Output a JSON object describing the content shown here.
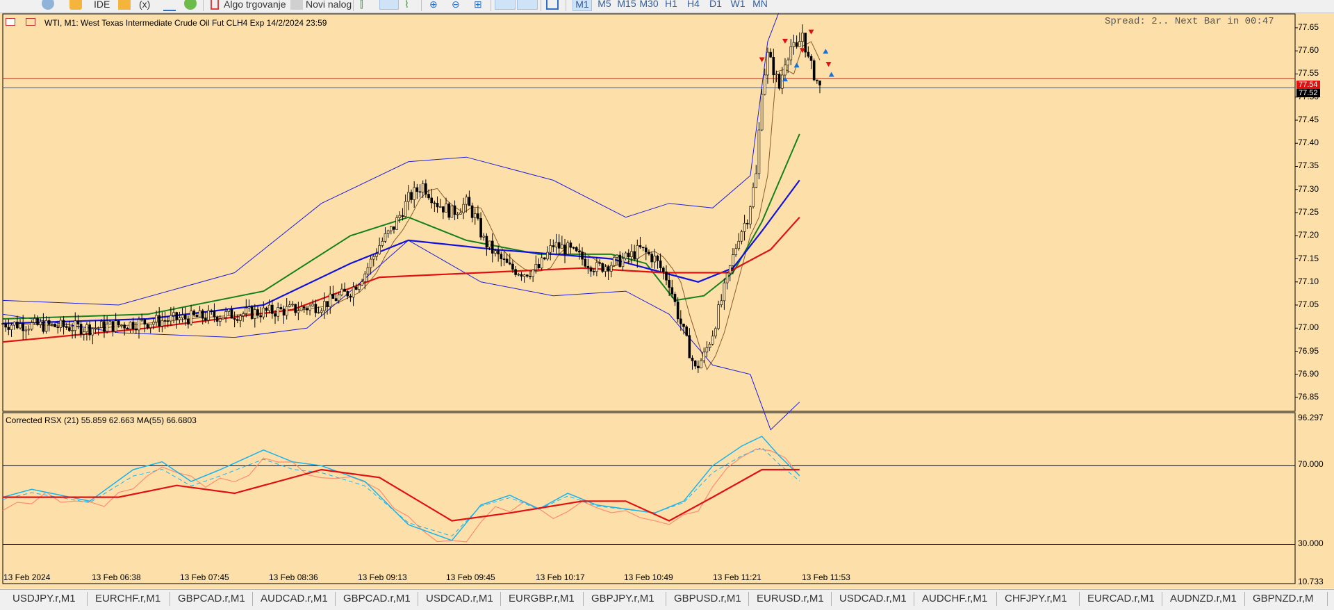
{
  "toolbar": {
    "items": [
      "IDE",
      "Algo trgovanje",
      "Novi nalog"
    ],
    "timeframes": [
      "M1",
      "M5",
      "M15",
      "M30",
      "H1",
      "H4",
      "D1",
      "W1",
      "MN"
    ],
    "active_timeframe": "M1"
  },
  "chart": {
    "symbol_info": "WTI, M1:  West Texas Intermediate Crude Oil Fut CLH4 Exp 14/2/2024 23:59",
    "spread_info": "Spread: 2.. Next Bar in 00:47",
    "ask_tag": "77.54",
    "bid_tag": "77.52",
    "price_ticks": [
      "77.65",
      "77.60",
      "77.55",
      "77.50",
      "77.45",
      "77.40",
      "77.35",
      "77.30",
      "77.25",
      "77.20",
      "77.15",
      "77.10",
      "77.05",
      "77.00",
      "76.95",
      "76.90",
      "76.85"
    ],
    "indicator_label": "Corrected RSX (21) 55.859 62.663 MA(55) 66.6803",
    "indicator_ticks": [
      "96.297",
      "70.000",
      "30.000",
      "10.733"
    ],
    "time_labels": [
      "13 Feb 2024",
      "13 Feb 06:38",
      "13 Feb 07:45",
      "13 Feb 08:36",
      "13 Feb 09:13",
      "13 Feb 09:45",
      "13 Feb 10:17",
      "13 Feb 10:49",
      "13 Feb 11:21",
      "13 Feb 11:53"
    ],
    "colors": {
      "background": "#fde0a9",
      "bollinger": "#1d1de0",
      "ema_green": "#14801e",
      "ema_blue": "#1010e0",
      "ema_red": "#e01010",
      "rsx_fast": "#17b3ee",
      "rsx_signal": "#e01010",
      "rsx_slow": "#ff8c70",
      "ask_line": "#e01010",
      "bid_line": "#555555"
    }
  },
  "chart_data": {
    "type": "candlestick",
    "timeframe": "M1",
    "y_range": [
      76.82,
      77.68
    ],
    "x_labels": [
      "13 Feb 2024",
      "13 Feb 06:38",
      "13 Feb 07:45",
      "13 Feb 08:36",
      "13 Feb 09:13",
      "13 Feb 09:45",
      "13 Feb 10:17",
      "13 Feb 10:49",
      "13 Feb 11:21",
      "13 Feb 11:53"
    ],
    "close_path": [
      [
        0,
        77.01
      ],
      [
        30,
        77.0
      ],
      [
        60,
        77.02
      ],
      [
        80,
        77.03
      ],
      [
        100,
        77.04
      ],
      [
        110,
        77.05
      ],
      [
        120,
        77.08
      ],
      [
        125,
        77.12
      ],
      [
        130,
        77.18
      ],
      [
        135,
        77.22
      ],
      [
        140,
        77.28
      ],
      [
        145,
        77.31
      ],
      [
        150,
        77.27
      ],
      [
        155,
        77.25
      ],
      [
        160,
        77.27
      ],
      [
        163,
        77.24
      ],
      [
        166,
        77.19
      ],
      [
        170,
        77.16
      ],
      [
        175,
        77.13
      ],
      [
        180,
        77.12
      ],
      [
        185,
        77.13
      ],
      [
        190,
        77.18
      ],
      [
        195,
        77.17
      ],
      [
        200,
        77.15
      ],
      [
        205,
        77.13
      ],
      [
        210,
        77.14
      ],
      [
        215,
        77.15
      ],
      [
        220,
        77.17
      ],
      [
        225,
        77.15
      ],
      [
        230,
        77.1
      ],
      [
        233,
        77.03
      ],
      [
        236,
        76.97
      ],
      [
        239,
        76.91
      ],
      [
        242,
        76.94
      ],
      [
        245,
        76.99
      ],
      [
        248,
        77.06
      ],
      [
        251,
        77.13
      ],
      [
        254,
        77.2
      ],
      [
        257,
        77.24
      ],
      [
        260,
        77.33
      ],
      [
        262,
        77.52
      ],
      [
        264,
        77.59
      ],
      [
        266,
        77.56
      ],
      [
        268,
        77.52
      ],
      [
        270,
        77.58
      ],
      [
        272,
        77.61
      ],
      [
        274,
        77.6
      ],
      [
        276,
        77.64
      ],
      [
        278,
        77.58
      ],
      [
        280,
        77.55
      ],
      [
        282,
        77.52
      ]
    ],
    "indicators": [
      {
        "name": "Bollinger upper",
        "points": [
          [
            0,
            77.06
          ],
          [
            40,
            77.05
          ],
          [
            80,
            77.12
          ],
          [
            110,
            77.27
          ],
          [
            140,
            77.36
          ],
          [
            160,
            77.37
          ],
          [
            190,
            77.32
          ],
          [
            215,
            77.24
          ],
          [
            230,
            77.27
          ],
          [
            245,
            77.26
          ],
          [
            258,
            77.33
          ],
          [
            264,
            77.62
          ],
          [
            275,
            77.8
          ]
        ]
      },
      {
        "name": "Bollinger lower",
        "points": [
          [
            0,
            77.03
          ],
          [
            40,
            76.99
          ],
          [
            80,
            76.98
          ],
          [
            105,
            77.0
          ],
          [
            120,
            77.08
          ],
          [
            140,
            77.19
          ],
          [
            165,
            77.1
          ],
          [
            190,
            77.07
          ],
          [
            215,
            77.08
          ],
          [
            230,
            77.03
          ],
          [
            245,
            76.92
          ],
          [
            258,
            76.9
          ],
          [
            265,
            76.78
          ],
          [
            275,
            76.84
          ]
        ]
      },
      {
        "name": "EMA green",
        "points": [
          [
            0,
            77.02
          ],
          [
            50,
            77.03
          ],
          [
            90,
            77.08
          ],
          [
            120,
            77.2
          ],
          [
            140,
            77.24
          ],
          [
            160,
            77.19
          ],
          [
            185,
            77.16
          ],
          [
            210,
            77.16
          ],
          [
            222,
            77.14
          ],
          [
            232,
            77.06
          ],
          [
            242,
            77.07
          ],
          [
            252,
            77.12
          ],
          [
            262,
            77.23
          ],
          [
            275,
            77.42
          ]
        ]
      },
      {
        "name": "EMA blue",
        "points": [
          [
            0,
            77.01
          ],
          [
            50,
            77.02
          ],
          [
            90,
            77.05
          ],
          [
            120,
            77.14
          ],
          [
            140,
            77.19
          ],
          [
            170,
            77.17
          ],
          [
            210,
            77.15
          ],
          [
            228,
            77.12
          ],
          [
            240,
            77.1
          ],
          [
            252,
            77.13
          ],
          [
            262,
            77.21
          ],
          [
            275,
            77.32
          ]
        ]
      },
      {
        "name": "EMA red",
        "points": [
          [
            0,
            76.97
          ],
          [
            50,
            77.0
          ],
          [
            100,
            77.04
          ],
          [
            130,
            77.11
          ],
          [
            165,
            77.12
          ],
          [
            200,
            77.13
          ],
          [
            228,
            77.12
          ],
          [
            250,
            77.12
          ],
          [
            265,
            77.17
          ],
          [
            275,
            77.24
          ]
        ]
      }
    ],
    "indicator_panel": {
      "name": "Corrected RSX (21)",
      "values": [
        55.859,
        62.663
      ],
      "ma": 66.6803,
      "y_range": [
        10.733,
        96.297
      ],
      "levels": [
        70.0,
        30.0
      ],
      "rsx_fast": [
        [
          0,
          54
        ],
        [
          10,
          58
        ],
        [
          30,
          52
        ],
        [
          45,
          68
        ],
        [
          55,
          72
        ],
        [
          65,
          62
        ],
        [
          75,
          68
        ],
        [
          90,
          78
        ],
        [
          100,
          72
        ],
        [
          110,
          70
        ],
        [
          125,
          62
        ],
        [
          140,
          40
        ],
        [
          155,
          32
        ],
        [
          165,
          50
        ],
        [
          175,
          55
        ],
        [
          185,
          48
        ],
        [
          195,
          56
        ],
        [
          205,
          50
        ],
        [
          215,
          48
        ],
        [
          225,
          46
        ],
        [
          235,
          52
        ],
        [
          245,
          70
        ],
        [
          255,
          80
        ],
        [
          262,
          85
        ],
        [
          268,
          75
        ],
        [
          275,
          65
        ]
      ],
      "rsx_signal": [
        [
          0,
          54
        ],
        [
          40,
          54
        ],
        [
          60,
          60
        ],
        [
          80,
          56
        ],
        [
          110,
          68
        ],
        [
          130,
          64
        ],
        [
          155,
          42
        ],
        [
          175,
          46
        ],
        [
          200,
          52
        ],
        [
          215,
          52
        ],
        [
          230,
          42
        ],
        [
          245,
          54
        ],
        [
          262,
          68
        ],
        [
          275,
          68
        ]
      ]
    }
  }
}
